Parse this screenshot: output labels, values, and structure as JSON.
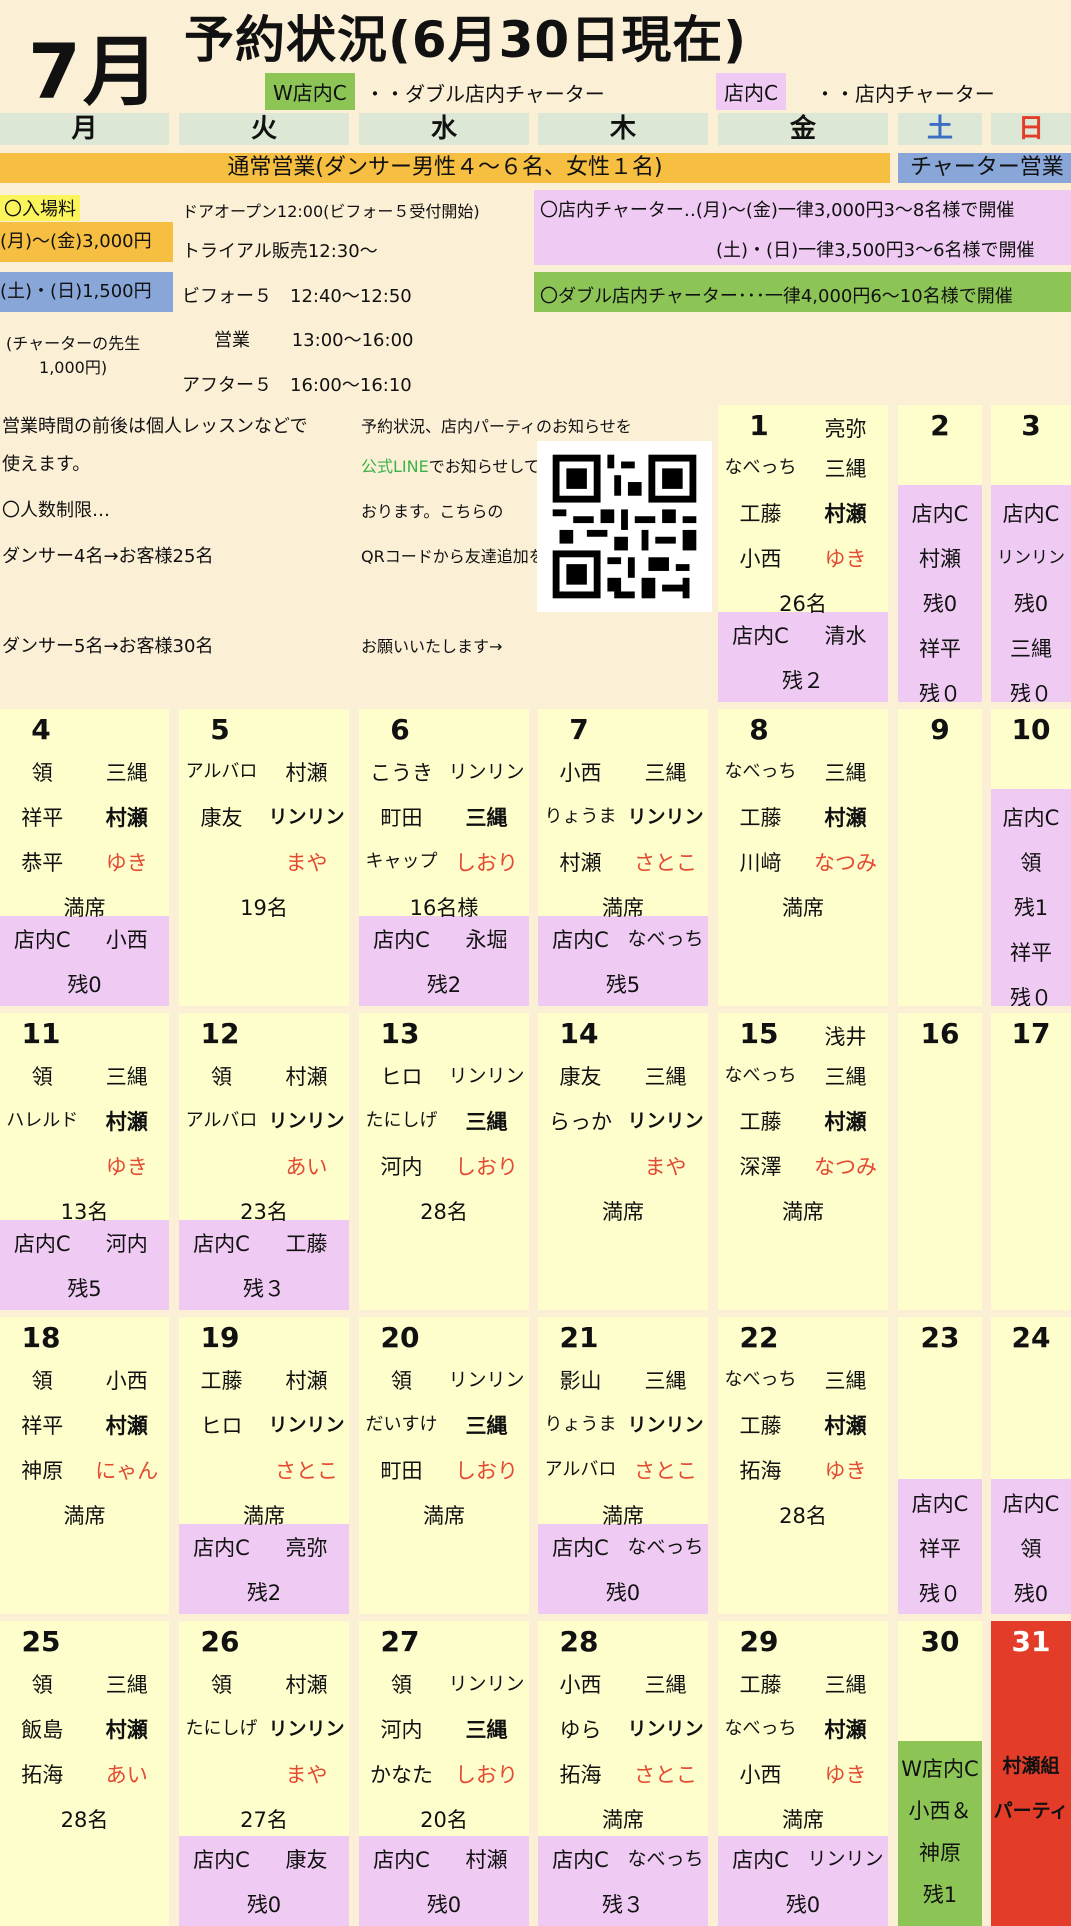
{
  "header": {
    "month": "7月",
    "title": "予約状況(6月30日現在)",
    "legend_w": "W店内C",
    "legend_w_desc": "・・ダブル店内チャーター",
    "legend_c": "店内C",
    "legend_c_desc": "・・店内チャーター"
  },
  "weekdays": [
    "月",
    "火",
    "水",
    "木",
    "金",
    "土",
    "日"
  ],
  "bars": {
    "hours": "通常営業(ダンサー男性４～６名、女性１名)",
    "charter": "チャーター営業"
  },
  "info": {
    "fee_label": "〇入場料",
    "fee_weekday": "(月)～(金)3,000円",
    "fee_weekend": "(土)・(日)1,500円",
    "fee_teacher": "(チャーターの先生\n1,000円)",
    "door": "ドアオープン12:00(ビフォー５受付開始)",
    "trial": "トライアル販売12:30～",
    "before5": "ビフォー５　12:40～12:50",
    "business": "営業　　 13:00～16:00",
    "after5": "アフター５　16:00～16:10",
    "charter1": "〇店内チャーター‥(月)～(金)一律3,000円3～8名様で開催",
    "charter2": "(土)・(日)一律3,500円3～6名様で開催",
    "charter3": "〇ダブル店内チャーター･･･一律4,000円6～10名様で開催",
    "lesson1": "営業時間の前後は個人レッスンなどで",
    "lesson2": "使えます。",
    "limit": "〇人数制限…",
    "limit4": "ダンサー4名→お客様25名",
    "limit5": "ダンサー5名→お客様30名",
    "line1": "予約状況、店内パーティのお知らせを",
    "line2a": "公式LINE",
    "line2b": "でお知らせして",
    "line3": "おります。こちらの",
    "line4": "QRコードから友達追加を",
    "line5": "お願いいたします→"
  },
  "colors": {
    "bg": "#fbefd6",
    "cell": "#fefecd",
    "pink": "#efcaf3",
    "green": "#8cc456",
    "red": "#e33d2a",
    "orange": "#f6bf42",
    "blue": "#88a6d8"
  },
  "days": [
    {
      "d": "1",
      "l1": [
        "亮弥"
      ],
      "rows": [
        [
          "なべっち",
          "三縄"
        ],
        [
          "工藤",
          "村瀬"
        ],
        [
          "小西",
          "ゆき"
        ]
      ],
      "count": "26名",
      "c": [
        "店内C",
        "清水"
      ],
      "rem": "残２"
    },
    {
      "d": "2",
      "sat": [
        "店内C",
        "村瀬",
        "残0",
        "祥平",
        "残０"
      ]
    },
    {
      "d": "3",
      "sun": [
        "店内C",
        "リンリン",
        "残0",
        "三縄",
        "残０"
      ]
    },
    {
      "d": "4",
      "rows": [
        [
          "領",
          "三縄"
        ],
        [
          "祥平",
          "村瀬"
        ],
        [
          "恭平",
          "ゆき"
        ]
      ],
      "count": "満席",
      "c": [
        "店内C",
        "小西"
      ],
      "rem": "残0"
    },
    {
      "d": "5",
      "rows": [
        [
          "アルバロ",
          "村瀬"
        ],
        [
          "康友",
          "リンリン"
        ],
        [
          "",
          "まや"
        ]
      ],
      "count": "19名"
    },
    {
      "d": "6",
      "rows": [
        [
          "こうき",
          "リンリン"
        ],
        [
          "町田",
          "三縄"
        ],
        [
          "キャップ",
          "しおり"
        ]
      ],
      "count": "16名様",
      "c": [
        "店内C",
        "永堀"
      ],
      "rem": "残2"
    },
    {
      "d": "7",
      "rows": [
        [
          "小西",
          "三縄"
        ],
        [
          "りょうま",
          "リンリン"
        ],
        [
          "村瀬",
          "さとこ"
        ]
      ],
      "count": "満席",
      "c": [
        "店内C",
        "なべっち"
      ],
      "rem": "残5"
    },
    {
      "d": "8",
      "rows": [
        [
          "なべっち",
          "三縄"
        ],
        [
          "工藤",
          "村瀬"
        ],
        [
          "川﨑",
          "なつみ"
        ]
      ],
      "count": "満席"
    },
    {
      "d": "9"
    },
    {
      "d": "10",
      "sun": [
        "店内C",
        "領",
        "残1",
        "祥平",
        "残０"
      ]
    },
    {
      "d": "11",
      "rows": [
        [
          "領",
          "三縄"
        ],
        [
          "ハレルド",
          "村瀬"
        ],
        [
          "",
          "ゆき"
        ]
      ],
      "count": "13名",
      "c": [
        "店内C",
        "河内"
      ],
      "rem": "残5"
    },
    {
      "d": "12",
      "rows": [
        [
          "領",
          "村瀬"
        ],
        [
          "アルバロ",
          "リンリン"
        ],
        [
          "",
          "あい"
        ]
      ],
      "count": "23名",
      "c": [
        "店内C",
        "工藤"
      ],
      "rem": "残３"
    },
    {
      "d": "13",
      "rows": [
        [
          "ヒロ",
          "リンリン"
        ],
        [
          "たにしげ",
          "三縄"
        ],
        [
          "河内",
          "しおり"
        ]
      ],
      "count": "28名"
    },
    {
      "d": "14",
      "rows": [
        [
          "康友",
          "三縄"
        ],
        [
          "らっか",
          "リンリン"
        ],
        [
          "",
          "まや"
        ]
      ],
      "count": "満席"
    },
    {
      "d": "15",
      "l1": [
        "浅井"
      ],
      "rows": [
        [
          "なべっち",
          "三縄"
        ],
        [
          "工藤",
          "村瀬"
        ],
        [
          "深澤",
          "なつみ"
        ]
      ],
      "count": "満席"
    },
    {
      "d": "16"
    },
    {
      "d": "17"
    },
    {
      "d": "18",
      "rows": [
        [
          "領",
          "小西"
        ],
        [
          "祥平",
          "村瀬"
        ],
        [
          "神原",
          "にゃん"
        ]
      ],
      "count": "満席"
    },
    {
      "d": "19",
      "rows": [
        [
          "工藤",
          "村瀬"
        ],
        [
          "ヒロ",
          "リンリン"
        ],
        [
          "",
          "さとこ"
        ]
      ],
      "count": "満席",
      "c": [
        "店内C",
        "亮弥"
      ],
      "rem": "残2"
    },
    {
      "d": "20",
      "rows": [
        [
          "領",
          "リンリン"
        ],
        [
          "だいすけ",
          "三縄"
        ],
        [
          "町田",
          "しおり"
        ]
      ],
      "count": "満席"
    },
    {
      "d": "21",
      "rows": [
        [
          "影山",
          "三縄"
        ],
        [
          "りょうま",
          "リンリン"
        ],
        [
          "アルバロ",
          "さとこ"
        ]
      ],
      "count": "満席",
      "c": [
        "店内C",
        "なべっち"
      ],
      "rem": "残0"
    },
    {
      "d": "22",
      "rows": [
        [
          "なべっち",
          "三縄"
        ],
        [
          "工藤",
          "村瀬"
        ],
        [
          "拓海",
          "ゆき"
        ]
      ],
      "count": "28名"
    },
    {
      "d": "23",
      "sat2": [
        "店内C",
        "祥平",
        "残０"
      ]
    },
    {
      "d": "24",
      "sat2": [
        "店内C",
        "領",
        "残0"
      ]
    },
    {
      "d": "25",
      "rows": [
        [
          "領",
          "三縄"
        ],
        [
          "飯島",
          "村瀬"
        ],
        [
          "拓海",
          "あい"
        ]
      ],
      "count": "28名"
    },
    {
      "d": "26",
      "rows": [
        [
          "領",
          "村瀬"
        ],
        [
          "たにしげ",
          "リンリン"
        ],
        [
          "",
          "まや"
        ]
      ],
      "count": "27名",
      "c": [
        "店内C",
        "康友"
      ],
      "rem": "残0"
    },
    {
      "d": "27",
      "rows": [
        [
          "領",
          "リンリン"
        ],
        [
          "河内",
          "三縄"
        ],
        [
          "かなた",
          "しおり"
        ]
      ],
      "count": "20名",
      "c": [
        "店内C",
        "村瀬"
      ],
      "rem": "残0"
    },
    {
      "d": "28",
      "rows": [
        [
          "小西",
          "三縄"
        ],
        [
          "ゆら",
          "リンリン"
        ],
        [
          "拓海",
          "さとこ"
        ]
      ],
      "count": "満席",
      "c": [
        "店内C",
        "なべっち"
      ],
      "rem": "残３"
    },
    {
      "d": "29",
      "rows": [
        [
          "工藤",
          "三縄"
        ],
        [
          "なべっち",
          "村瀬"
        ],
        [
          "小西",
          "ゆき"
        ]
      ],
      "count": "満席",
      "c": [
        "店内C",
        "リンリン"
      ],
      "rem": "残0"
    },
    {
      "d": "30",
      "w": [
        "W店内C",
        "小西＆",
        "神原",
        "残1"
      ]
    },
    {
      "d": "31",
      "party": [
        "村瀬組",
        "パーティ"
      ]
    }
  ]
}
